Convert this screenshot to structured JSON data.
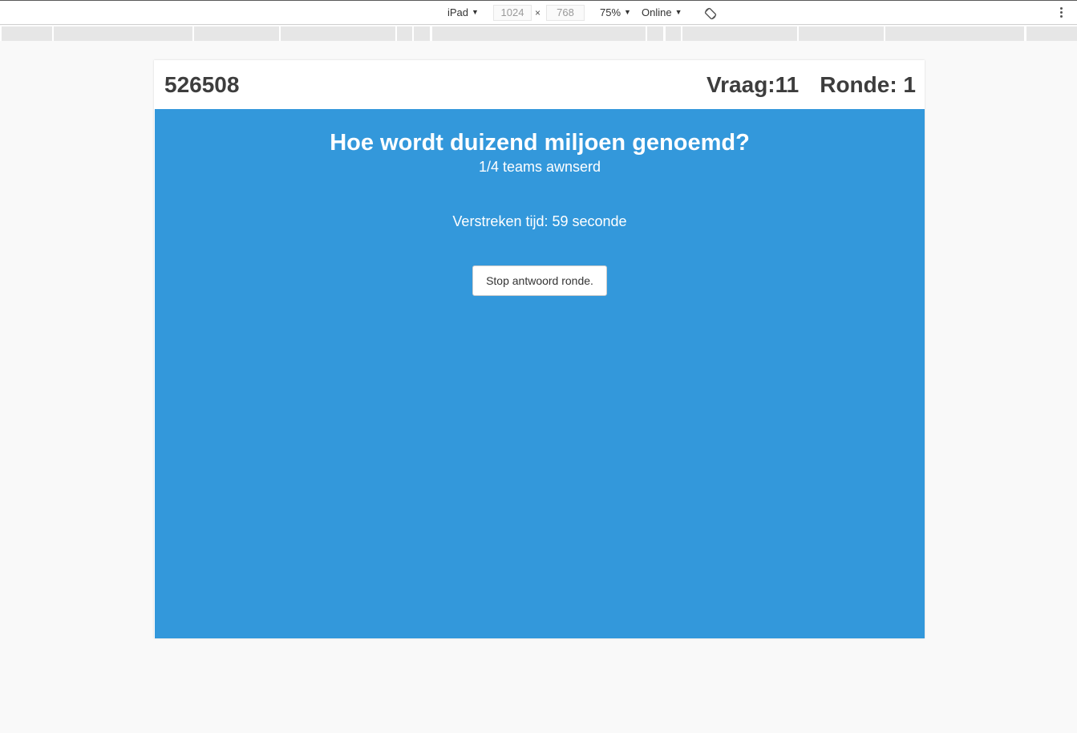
{
  "devtools": {
    "device_label": "iPad",
    "width_value": "1024",
    "height_value": "768",
    "times_symbol": "×",
    "zoom_label": "75%",
    "throttle_label": "Online",
    "caret": "▼",
    "icons": [
      "rotate-icon",
      "more-options-icon",
      "dropdown-caret-icon"
    ]
  },
  "header": {
    "game_code": "526508",
    "question_label": "Vraag:11",
    "round_label": "Ronde: 1"
  },
  "main": {
    "question": "Hoe wordt duizend miljoen genoemd?",
    "teams_answered": "1/4 teams awnserd",
    "elapsed_label": "Verstreken tijd:",
    "elapsed_value": "59 seconde",
    "stop_button_label": "Stop antwoord ronde."
  },
  "colors": {
    "panel_background": "#3398db",
    "header_text": "#3d3d3d",
    "page_background": "#f9f9f9"
  }
}
